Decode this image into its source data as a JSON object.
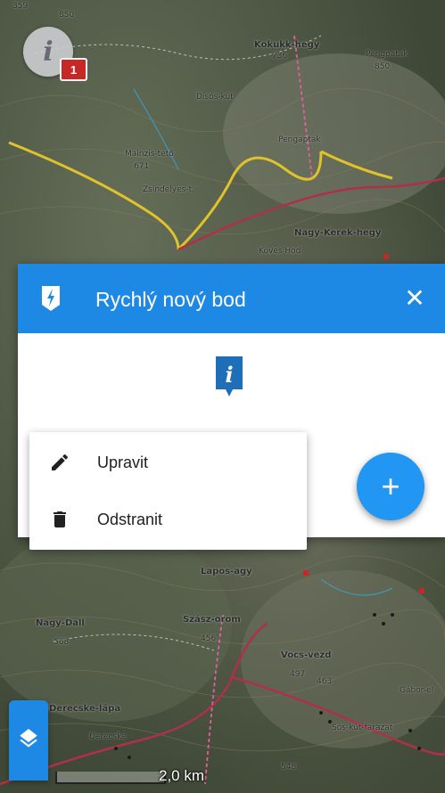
{
  "map": {
    "labels": [
      "359",
      "850",
      "Kokukk-hegy",
      "736",
      "Pengpatak",
      "850",
      "Disós-kút",
      "Mainzis-tető",
      "671",
      "Zsindelyes-t.",
      "Pengaptak",
      "Nagy-Kerek-hegy",
      "Köves Hod",
      "Lapos-agy",
      "Nagy-Dall",
      "568",
      "Szász-orom",
      "456",
      "Vocs-vezd",
      "497",
      "463",
      "Derecske-lápa",
      "Derecske",
      "548",
      "Sós-kút-farazat",
      "Gábor-el"
    ]
  },
  "info_button": {
    "glyph": "i",
    "badge": "1"
  },
  "dialog": {
    "title": "Rychlý nový bod",
    "close": "✕",
    "poi_glyph": "i"
  },
  "menu": {
    "items": [
      {
        "label": "Upravit",
        "icon": "pencil-icon"
      },
      {
        "label": "Odstranit",
        "icon": "trash-icon"
      }
    ]
  },
  "fab": {
    "label": "+"
  },
  "scale": {
    "text": "2,0 km"
  },
  "colors": {
    "primary": "#1e88e5",
    "fab": "#2196f3",
    "badge": "#c62828"
  }
}
